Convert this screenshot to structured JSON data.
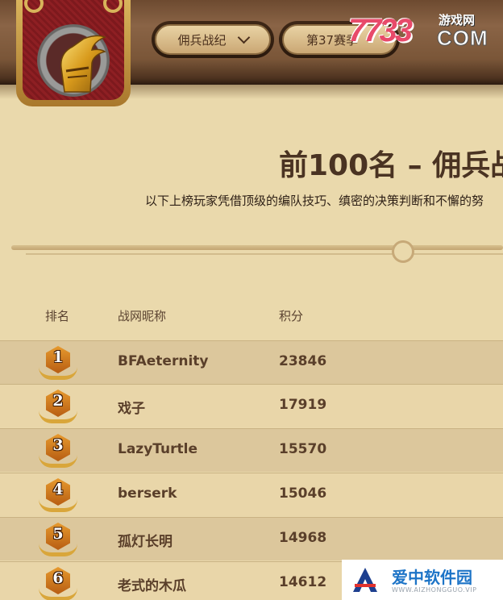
{
  "nav": {
    "mode_select": "佣兵战纪",
    "season_select": "第37赛季"
  },
  "watermark_top": {
    "digits": "7733",
    "site": "游戏网",
    "domain": "COM"
  },
  "heading": {
    "title": "前100名 – 佣兵战",
    "subtitle": "以下上榜玩家凭借顶级的编队技巧、缜密的决策判断和不懈的努"
  },
  "table": {
    "columns": [
      "排名",
      "战网昵称",
      "积分"
    ],
    "rows": [
      {
        "rank": "1",
        "name": "BFAeternity",
        "score": "23846"
      },
      {
        "rank": "2",
        "name": "戏子",
        "score": "17919"
      },
      {
        "rank": "3",
        "name": "LazyTurtle",
        "score": "15570"
      },
      {
        "rank": "4",
        "name": "berserk",
        "score": "15046"
      },
      {
        "rank": "5",
        "name": "孤灯长明",
        "score": "14968"
      },
      {
        "rank": "6",
        "name": "老式的木瓜",
        "score": "14612"
      }
    ]
  },
  "watermark_bottom": {
    "name": "爱中软件园",
    "url": "WWW.AIZHONGGUO.VIP"
  },
  "colors": {
    "accent_red": "#8e1f23",
    "gold": "#d9b45c",
    "row_dark": "#dcc79c",
    "row_light": "#e9d6a9"
  }
}
